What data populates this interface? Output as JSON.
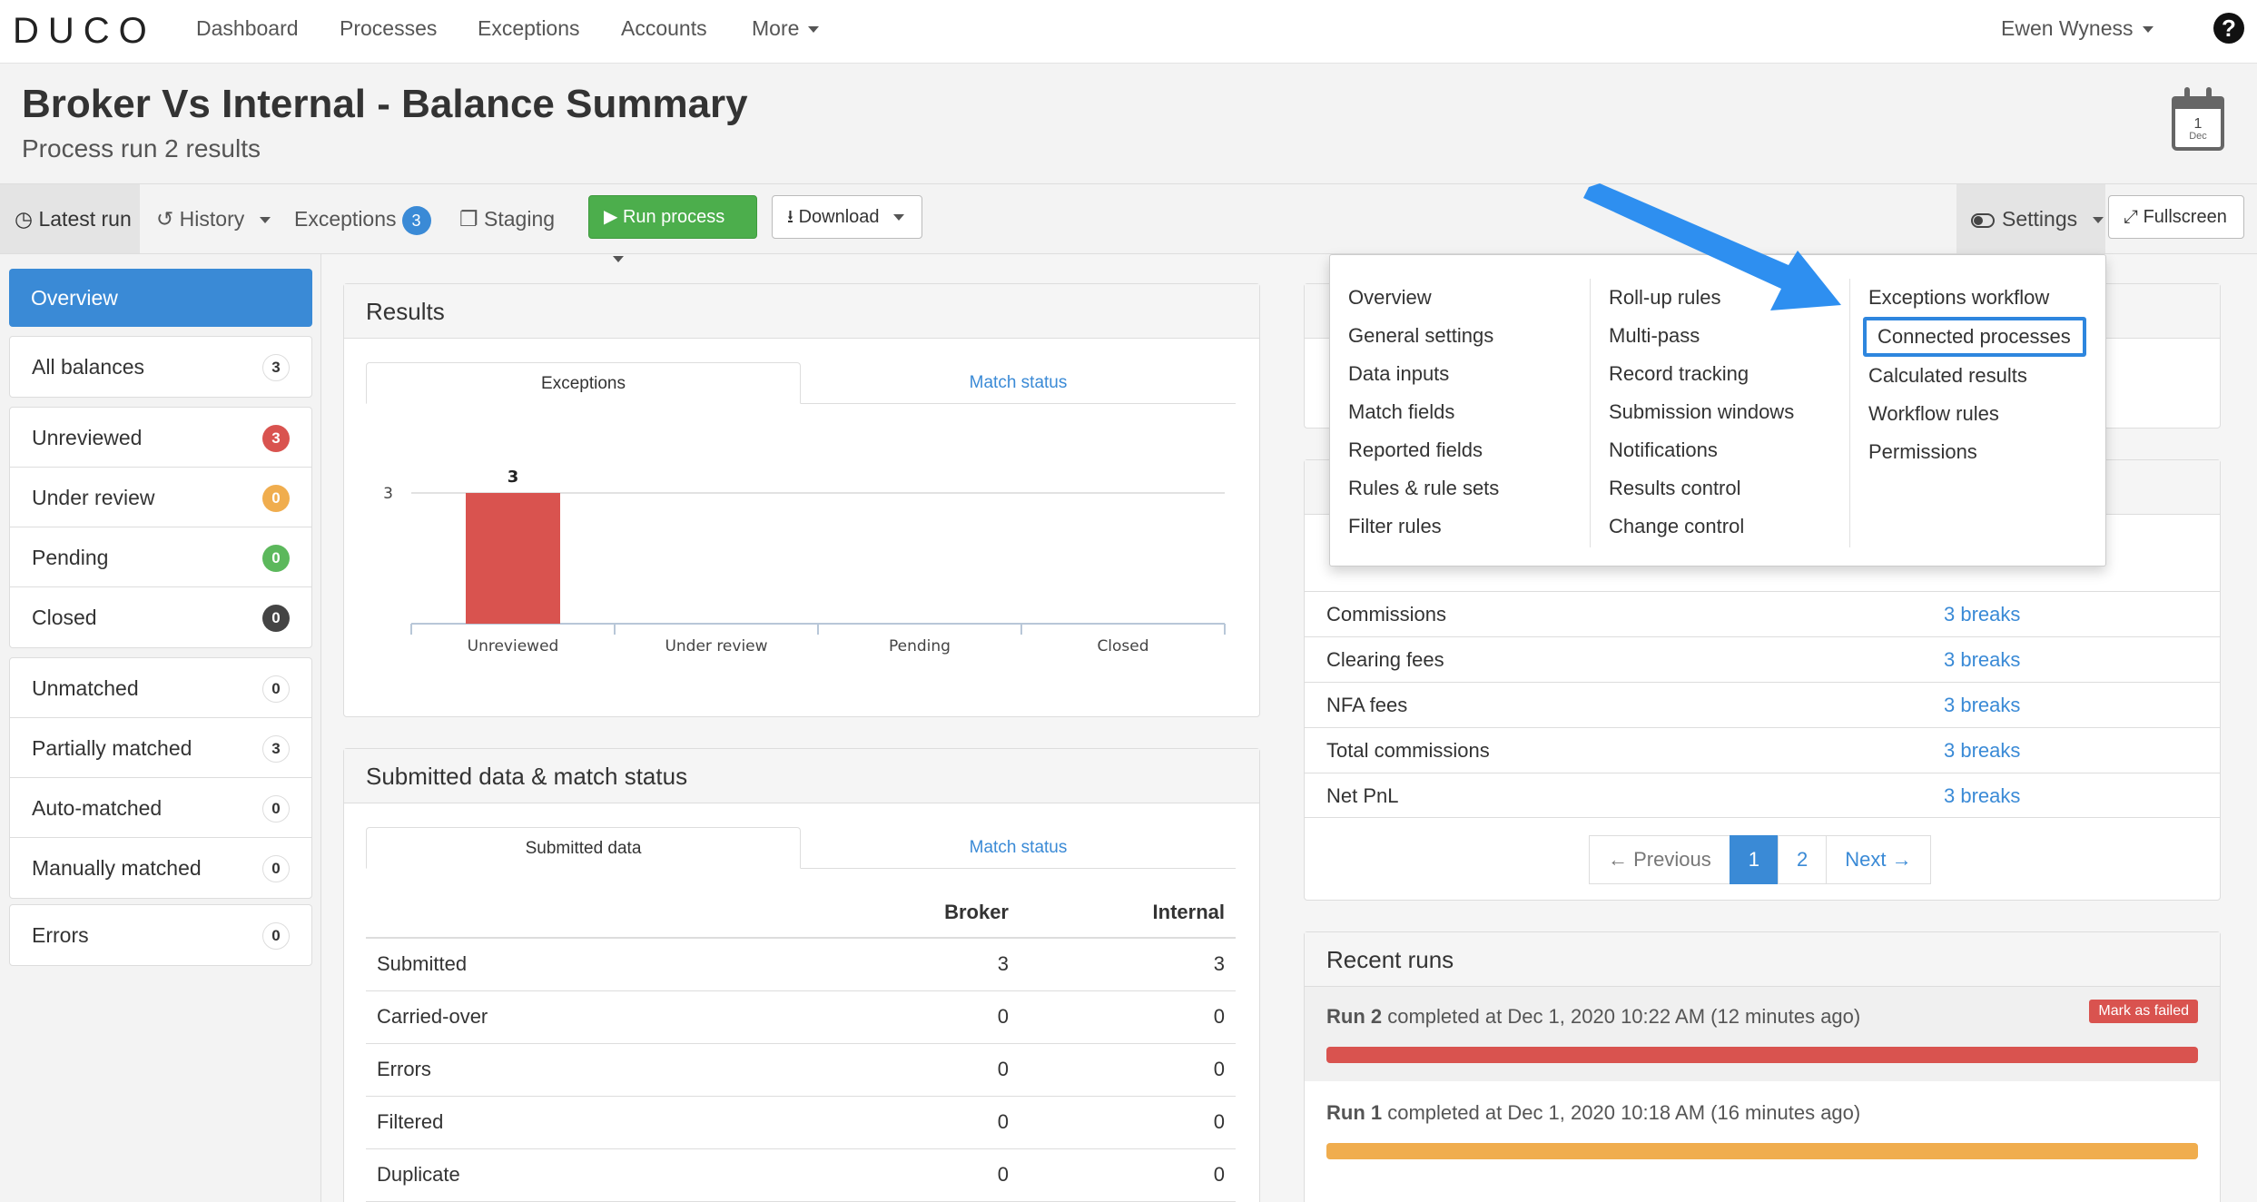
{
  "app": {
    "logo": "DUCO"
  },
  "nav": {
    "items": [
      "Dashboard",
      "Processes",
      "Exceptions",
      "Accounts",
      "More"
    ],
    "user": "Ewen Wyness",
    "help": "?"
  },
  "header": {
    "title": "Broker Vs Internal - Balance Summary",
    "subtitle": "Process run 2 results",
    "calendar_day": "1",
    "calendar_month": "Dec"
  },
  "toolbar": {
    "latest_run": "Latest run",
    "history": "History",
    "exceptions": "Exceptions",
    "exceptions_count": "3",
    "staging": "Staging",
    "run_process": "Run process",
    "download": "Download",
    "settings": "Settings",
    "fullscreen": "Fullscreen"
  },
  "sidebar": {
    "overview": "Overview",
    "all_balances": {
      "label": "All balances",
      "count": "3"
    },
    "status": [
      {
        "label": "Unreviewed",
        "count": "3"
      },
      {
        "label": "Under review",
        "count": "0"
      },
      {
        "label": "Pending",
        "count": "0"
      },
      {
        "label": "Closed",
        "count": "0"
      }
    ],
    "match": [
      {
        "label": "Unmatched",
        "count": "0"
      },
      {
        "label": "Partially matched",
        "count": "3"
      },
      {
        "label": "Auto-matched",
        "count": "0"
      },
      {
        "label": "Manually matched",
        "count": "0"
      }
    ],
    "errors": {
      "label": "Errors",
      "count": "0"
    }
  },
  "results": {
    "title": "Results",
    "tabs": [
      "Exceptions",
      "Match status"
    ]
  },
  "chart_data": {
    "type": "bar",
    "categories": [
      "Unreviewed",
      "Under review",
      "Pending",
      "Closed"
    ],
    "values": [
      3,
      0,
      0,
      0
    ],
    "data_labels": [
      "3",
      "",
      "",
      ""
    ],
    "y_ticks": [
      "3"
    ],
    "ylim": [
      0,
      3
    ],
    "bar_color": "#d9534f",
    "grid": true
  },
  "submitted": {
    "title": "Submitted data & match status",
    "tabs": [
      "Submitted data",
      "Match status"
    ],
    "columns": [
      "",
      "Broker",
      "Internal"
    ],
    "rows": [
      [
        "Submitted",
        "3",
        "3"
      ],
      [
        "Carried-over",
        "0",
        "0"
      ],
      [
        "Errors",
        "0",
        "0"
      ],
      [
        "Filtered",
        "0",
        "0"
      ],
      [
        "Duplicate",
        "0",
        "0"
      ]
    ]
  },
  "breaks": {
    "rows": [
      {
        "label": "Commissions",
        "value": "3 breaks"
      },
      {
        "label": "Clearing fees",
        "value": "3 breaks"
      },
      {
        "label": "NFA fees",
        "value": "3 breaks"
      },
      {
        "label": "Total commissions",
        "value": "3 breaks"
      },
      {
        "label": "Net PnL",
        "value": "3 breaks"
      }
    ],
    "pagination": {
      "previous": "← Previous",
      "pages": [
        "1",
        "2"
      ],
      "next": "Next →"
    }
  },
  "recent_runs": {
    "title": "Recent runs",
    "runs": [
      {
        "name": "Run 2",
        "text": "completed at Dec 1, 2020 10:22 AM (12 minutes ago)",
        "action": "Mark as failed",
        "progress": 1.0,
        "color": "#d9534f"
      },
      {
        "name": "Run 1",
        "text": "completed at Dec 1, 2020 10:18 AM (16 minutes ago)",
        "progress": 1.0,
        "color": "#f0ad4e"
      }
    ]
  },
  "settings_menu": {
    "col1": [
      "Overview",
      "General settings",
      "Data inputs",
      "Match fields",
      "Reported fields",
      "Rules & rule sets",
      "Filter rules"
    ],
    "col2": [
      "Roll-up rules",
      "Multi-pass",
      "Record tracking",
      "Submission windows",
      "Notifications",
      "Results control",
      "Change control"
    ],
    "col3": [
      "Exceptions workflow",
      "Connected processes",
      "Calculated results",
      "Workflow rules",
      "Permissions"
    ],
    "highlighted": "Connected processes"
  },
  "colors": {
    "accent": "#3a8ad6",
    "green": "#4cae4c",
    "red": "#d9534f",
    "orange": "#f0ad4e",
    "arrow": "#2e8ff0"
  }
}
